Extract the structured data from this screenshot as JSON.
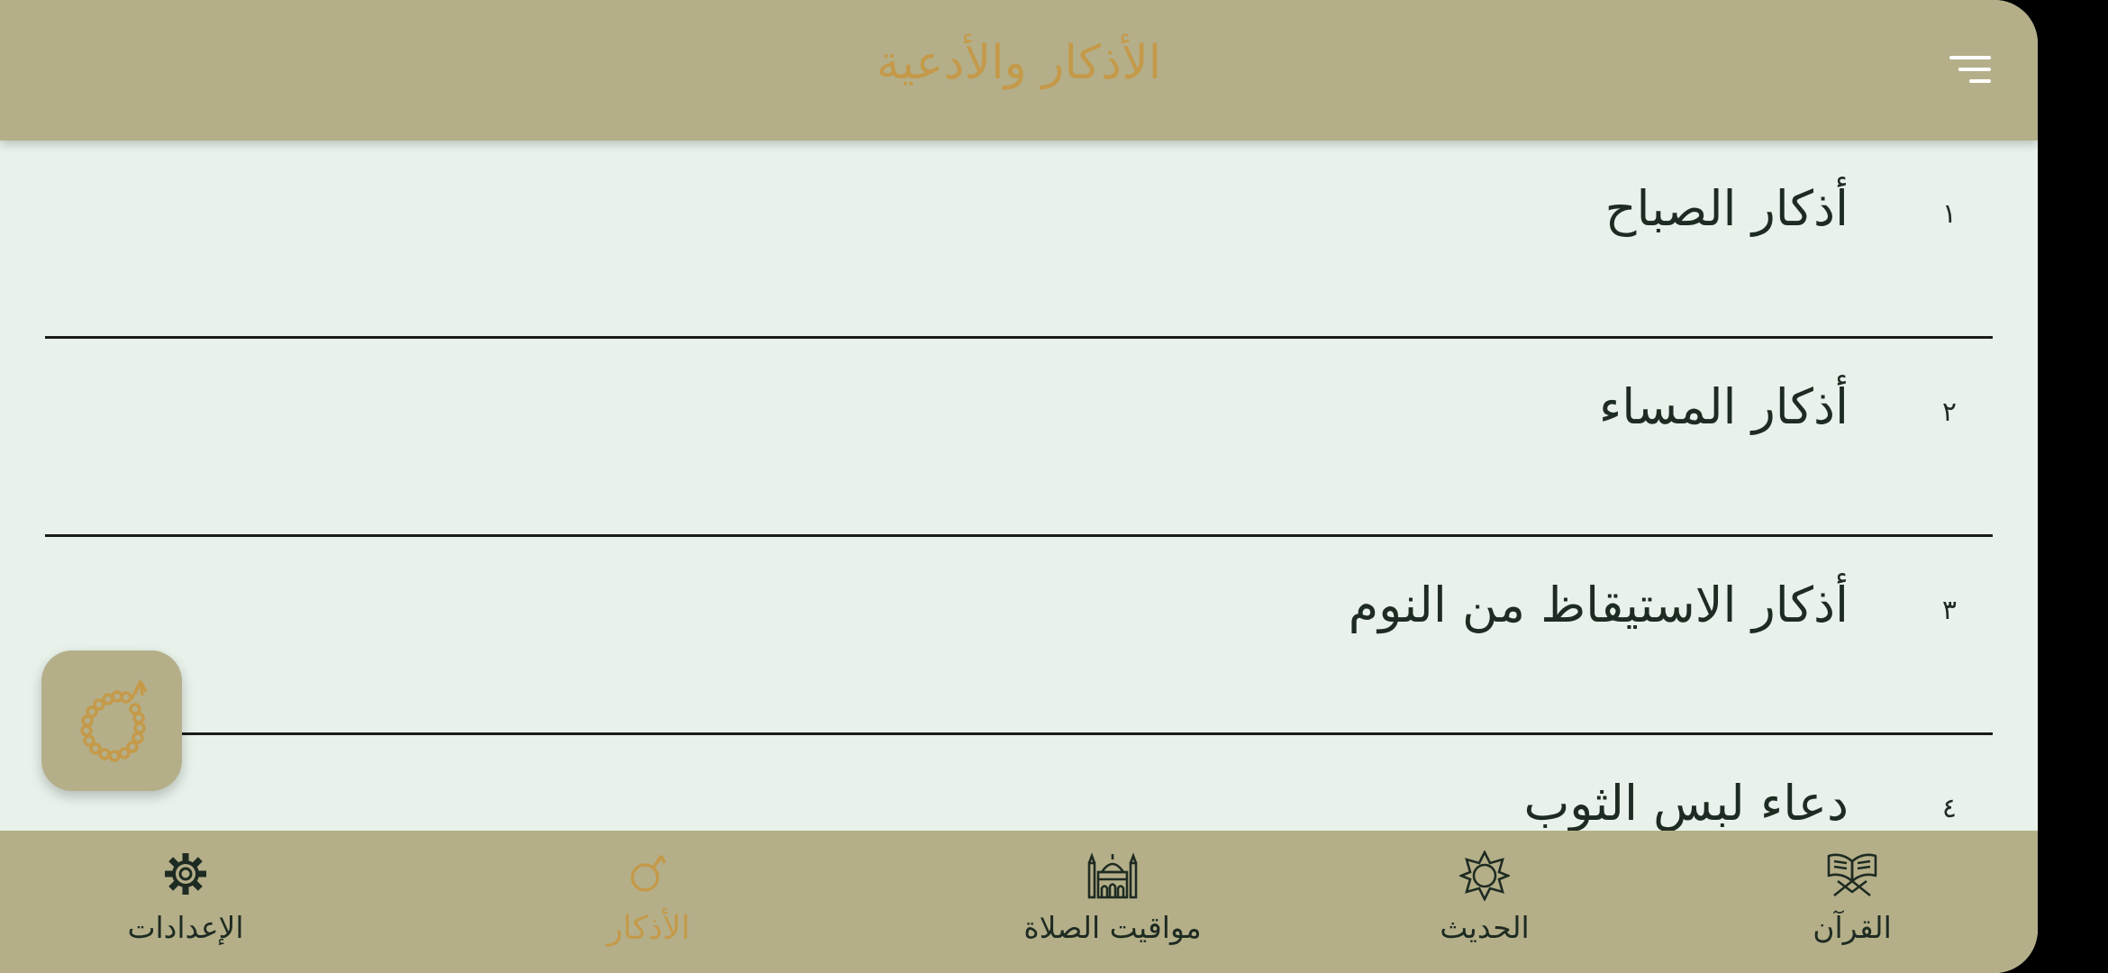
{
  "app_bar": {
    "title": "الأذكار والأدعية",
    "menu_icon": "menu-icon"
  },
  "list_items": [
    {
      "number": "١",
      "label": "أذكار الصباح"
    },
    {
      "number": "٢",
      "label": "أذكار المساء"
    },
    {
      "number": "٣",
      "label": "أذكار الاستيقاظ من النوم"
    },
    {
      "number": "٤",
      "label": "دعاء لبس الثوب"
    }
  ],
  "fab": {
    "icon": "prayer-beads-icon"
  },
  "bottom_nav": {
    "items": [
      {
        "label": "الإعدادات",
        "icon": "gear-icon",
        "active": false
      },
      {
        "label": "الأذكار",
        "icon": "prayer-beads-icon",
        "active": true
      },
      {
        "label": "مواقيت الصلاة",
        "icon": "mosque-icon",
        "active": false
      },
      {
        "label": "الحديث",
        "icon": "star-icon",
        "active": false
      },
      {
        "label": "القرآن",
        "icon": "quran-icon",
        "active": false
      }
    ]
  },
  "colors": {
    "bar": "#b4af89",
    "background": "#e8f1ea",
    "accent": "#c49a4a",
    "text": "#1e2b22"
  }
}
